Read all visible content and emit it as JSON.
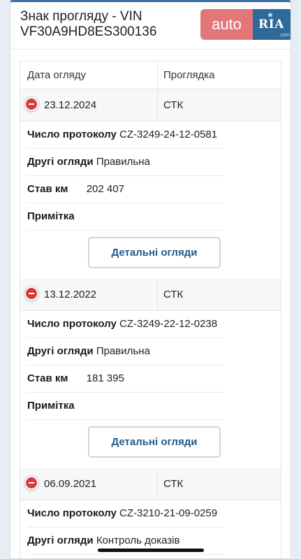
{
  "header": {
    "title": "Знак прогляду - VIN VF30A9HD8ES300136",
    "logo_auto": "auto",
    "logo_ria": "RIA",
    "logo_com": ".com"
  },
  "table": {
    "col_date": "Дата огляду",
    "col_type": "Проглядка"
  },
  "labels": {
    "protocol": "Число протоколу",
    "other": "Другі огляди",
    "km": "Став км",
    "note": "Примітка",
    "details_button": "Детальні огляди"
  },
  "records": [
    {
      "date": "23.12.2024",
      "type": "СТК",
      "protocol": "CZ-3249-24-12-0581",
      "other": "Правильна",
      "km": "202 407",
      "note": ""
    },
    {
      "date": "13.12.2022",
      "type": "СТК",
      "protocol": "CZ-3249-22-12-0238",
      "other": "Правильна",
      "km": "181 395",
      "note": ""
    },
    {
      "date": "06.09.2021",
      "type": "СТК",
      "protocol": "CZ-3210-21-09-0259",
      "other": "Контроль доказів"
    }
  ],
  "colors": {
    "accent": "#1f5a8a",
    "status_minus": "#d63a3a",
    "logo_auto_bg": "#e2777a",
    "logo_ria_bg": "#2d6a9a"
  }
}
